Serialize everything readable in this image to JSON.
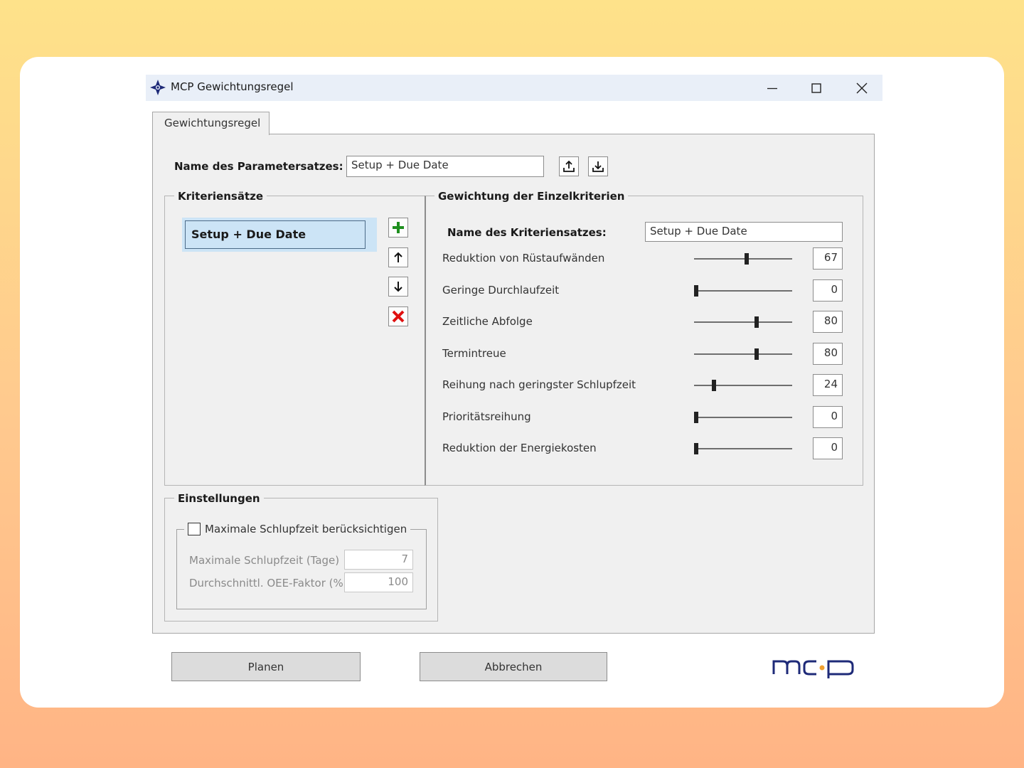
{
  "window": {
    "title": "MCP Gewichtungsregel",
    "tab_label": "Gewichtungsregel"
  },
  "paramset": {
    "label": "Name des Parametersatzes:",
    "value": "Setup + Due Date"
  },
  "criteria_sets": {
    "group_title": "Kriteriensätze",
    "items": [
      "Setup + Due Date"
    ]
  },
  "weighting": {
    "group_title": "Gewichtung der Einzelkriterien",
    "name_label": "Name des Kriteriensatzes:",
    "name_value": "Setup + Due Date",
    "criteria": [
      {
        "label": "Reduktion von Rüstaufwänden",
        "value": "67",
        "level": 67
      },
      {
        "label": "Geringe Durchlaufzeit",
        "value": "0",
        "level": 0
      },
      {
        "label": "Zeitliche Abfolge",
        "value": "80",
        "level": 80
      },
      {
        "label": "Termintreue",
        "value": "80",
        "level": 80
      },
      {
        "label": "Reihung nach geringster Schlupfzeit",
        "value": "24",
        "level": 24
      },
      {
        "label": "Prioritätsreihung",
        "value": "0",
        "level": 0
      },
      {
        "label": "Reduktion der Energiekosten",
        "value": "0",
        "level": 0
      }
    ]
  },
  "settings": {
    "group_title": "Einstellungen",
    "checkbox_label": "Maximale Schlupfzeit berücksichtigen",
    "checked": false,
    "max_slack_label": "Maximale Schlupfzeit (Tage)",
    "max_slack_value": "7",
    "oee_label": "Durchschnittl. OEE-Faktor (%)",
    "oee_value": "100"
  },
  "buttons": {
    "plan": "Planen",
    "cancel": "Abbrechen"
  },
  "colors": {
    "accent_blue": "#1e2a78",
    "logo_dot": "#f0a030",
    "selection": "#cce4f6",
    "add_green": "#1f8f1f",
    "delete_red": "#e01010"
  }
}
